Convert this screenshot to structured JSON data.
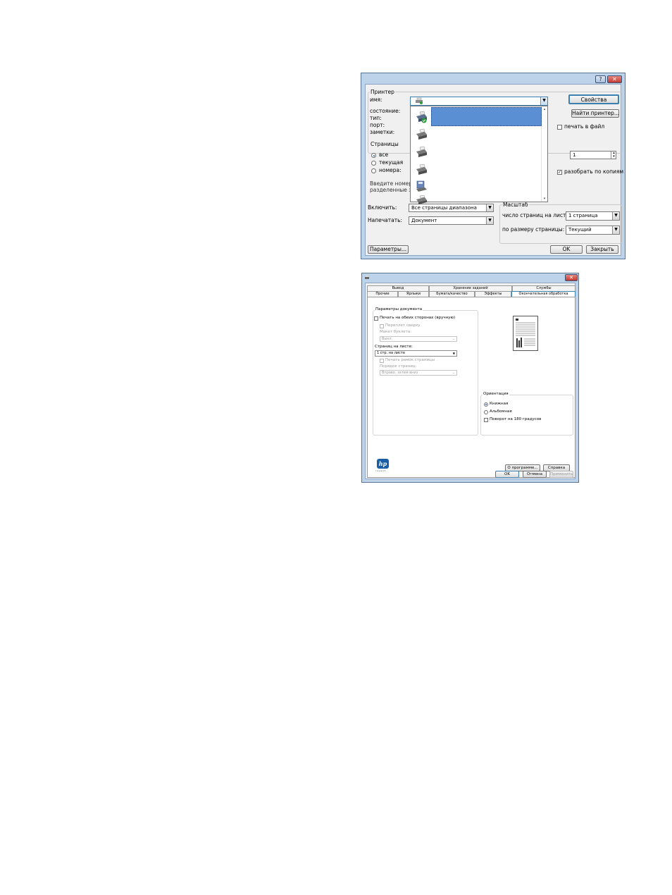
{
  "print_dialog": {
    "title_help": "?",
    "title_close": "✕",
    "printer_group": "Принтер",
    "name_label": "имя:",
    "status_label": "состояние:",
    "type_label": "тип:",
    "port_label": "порт:",
    "notes_label": "заметки:",
    "properties_button": "Свойства",
    "find_printer_button": "Найти принтер...",
    "print_to_file": "печать в файл",
    "pages_group": "Страницы",
    "all_radio": "все",
    "current_radio": "текущая",
    "numbers_radio": "номера:",
    "hint_line1": "Введите номер",
    "hint_line2": "разделенные з",
    "copies_value": "1",
    "collate": "разобрать по копиям",
    "zoom_group": "Масштаб",
    "pages_per_sheet_label": "число страниц на листе:",
    "pages_per_sheet_value": "1 страница",
    "scale_label": "по размеру страницы:",
    "scale_value": "Текущий",
    "include_label": "Включить:",
    "include_value": "Все страницы диапазона",
    "print_what_label": "Напечатать:",
    "print_what_value": "Документ",
    "options_button": "Параметры...",
    "ok_button": "OK",
    "close_button": "Закрыть"
  },
  "properties_dialog": {
    "title_close": "✕",
    "tabs_row1": [
      "Вывод",
      "Хранение заданий",
      "Службы"
    ],
    "tabs_row2": [
      "Прочие",
      "Ярлыки",
      "Бумага/качество",
      "Эффекты",
      "Окончательная обработка"
    ],
    "doc_options_group": "Параметры документа",
    "duplex_manual": "Печать на обеих сторонах (вручную)",
    "flip_up": "Переплет сверху",
    "booklet_label": "Макет буклета:",
    "booklet_value": "Выкл.",
    "pages_per_sheet_label": "Страниц на листе:",
    "pages_per_sheet_value": "1 стр. на листе",
    "print_borders": "Печать рамок страницы",
    "page_order_label": "Порядок страниц:",
    "page_order_value": "Вправо, затем вниз",
    "orientation_group": "Ориентация",
    "portrait": "Книжная",
    "landscape": "Альбомная",
    "rotate180": "Поворот на 180 градусов",
    "about_button": "О программе...",
    "help_button": "Справка",
    "ok_button": "OK",
    "cancel_button": "Отмена",
    "apply_button": "Применить",
    "hp_logo_text": "hp",
    "hp_invent": "i n v e n t"
  },
  "colors": {
    "selection": "#5b8fd3",
    "titlebar": "#bcd3ea",
    "close_red": "#d9403a"
  }
}
